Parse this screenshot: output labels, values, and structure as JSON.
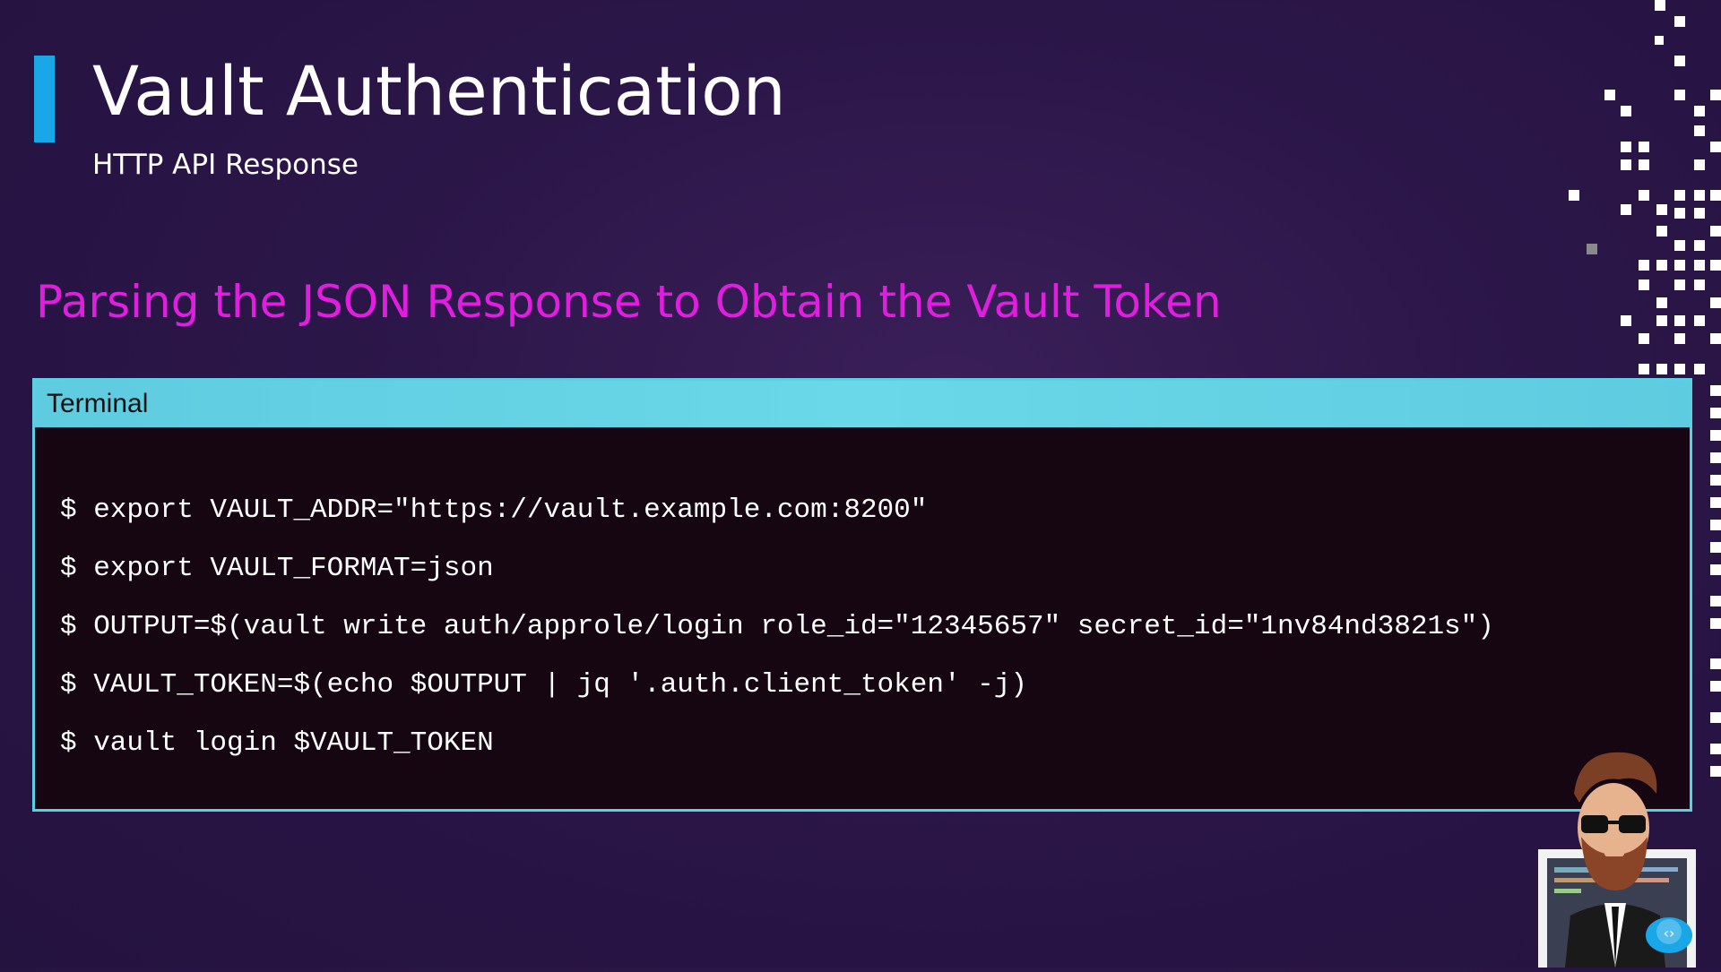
{
  "slide": {
    "title": "Vault Authentication",
    "subtitle": "HTTP API Response",
    "heading": "Parsing the JSON Response to Obtain the Vault Token",
    "accent_color": "#1aa7e8",
    "heading_color": "#e11ee0"
  },
  "terminal": {
    "title": "Terminal",
    "header_color": "#5fcbe0",
    "lines": [
      "$ export VAULT_ADDR=\"https://vault.example.com:8200\"",
      "$ export VAULT_FORMAT=json",
      "$ OUTPUT=$(vault write auth/approle/login role_id=\"12345657\" secret_id=\"1nv84nd3821s\")",
      "$ VAULT_TOKEN=$(echo $OUTPUT | jq '.auth.client_token' -j)",
      "$ vault login $VAULT_TOKEN"
    ]
  },
  "decorations": {
    "presenter_avatar": "presenter-avatar-icon",
    "pixel_pattern": "pixel-dots-decoration"
  }
}
